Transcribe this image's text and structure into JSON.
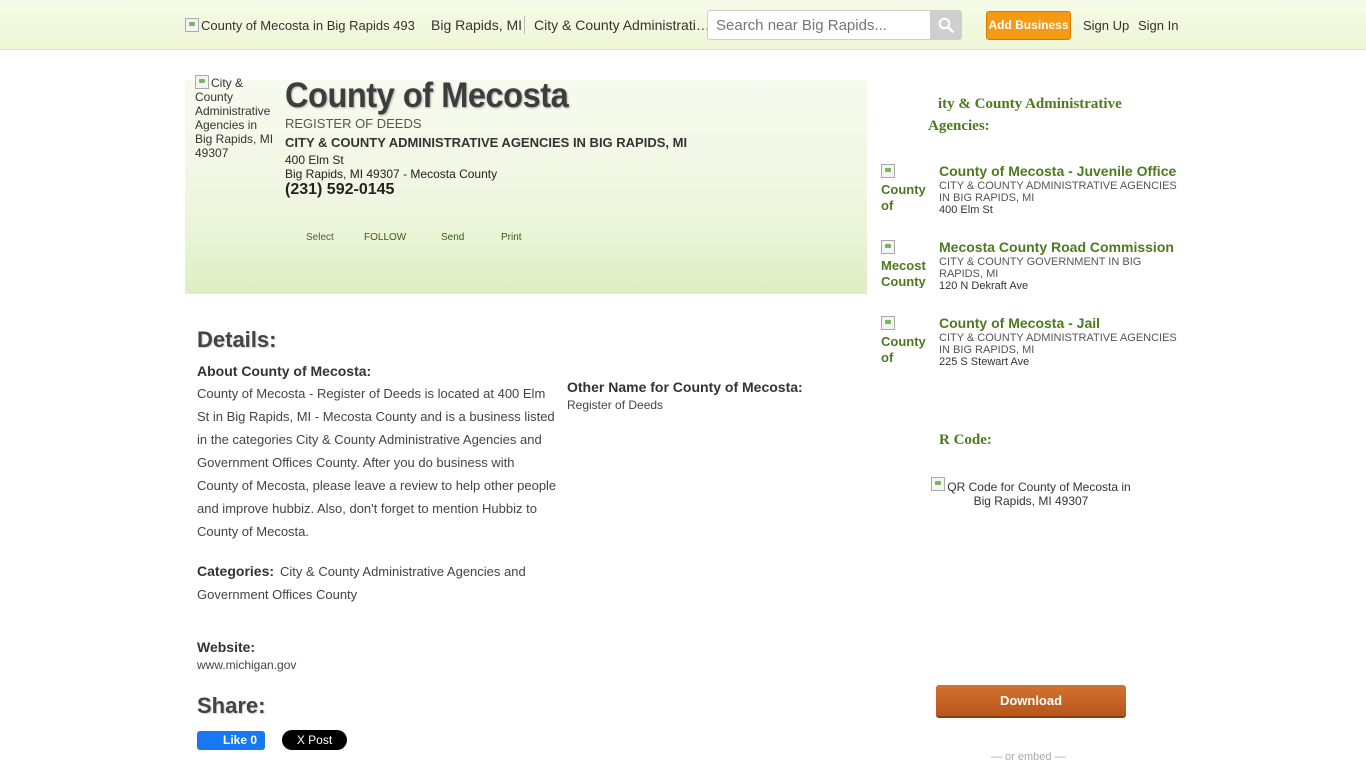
{
  "header": {
    "logo_alt": "County of Mecosta in Big Rapids 49307",
    "crumb_city": "Big Rapids, MI",
    "crumb_category": "City & County Administrati…",
    "search_placeholder": "Search near Big Rapids...",
    "add_business": "Add Business",
    "sign_up": "Sign Up",
    "sign_in": "Sign In"
  },
  "business": {
    "image_alt": "City & County Administrative Agencies in Big Rapids, MI 49307",
    "name": "County of Mecosta",
    "subtitle": "REGISTER OF DEEDS",
    "category_line": "CITY & COUNTY ADMINISTRATIVE AGENCIES IN BIG RAPIDS, MI",
    "address_line1": "400 Elm St",
    "address_line2": "Big Rapids, MI 49307 - Mecosta County",
    "phone": "(231) 592-0145",
    "actions": {
      "select": "Select",
      "follow": "FOLLOW",
      "send": "Send",
      "print": "Print"
    }
  },
  "details": {
    "heading": "Details:",
    "about_label": "About County of Mecosta:",
    "about_text": "County of Mecosta - Register of Deeds is located at 400 Elm St in Big Rapids, MI - Mecosta County and is a business listed in the categories City & County Administrative Agencies and Government Offices County. After you do business with County of Mecosta, please leave a review to help other people and improve hubbiz. Also, don't forget to mention Hubbiz to County of Mecosta.",
    "other_name_label": "Other Name for County of Mecosta:",
    "other_name_value": "Register of Deeds",
    "categories_label": "Categories:",
    "categories_value": "City & County Administrative Agencies and Government Offices County",
    "website_label": "Website:",
    "website_value": "www.michigan.gov"
  },
  "share": {
    "heading": "Share:",
    "fb_like": "Like 0",
    "tw_post": "X Post"
  },
  "sidebar": {
    "nearby_heading_line1": "ity & County Administrative",
    "nearby_heading_line2": "Agencies:",
    "nearby": [
      {
        "thumb_alt": "County of",
        "title": "County of Mecosta - Juvenile Office",
        "category": "CITY & COUNTY ADMINISTRATIVE AGENCIES IN BIG RAPIDS, MI",
        "address": "400 Elm St"
      },
      {
        "thumb_alt": "Mecost County",
        "title": "Mecosta County Road Commission",
        "category": "CITY & COUNTY GOVERNMENT IN BIG RAPIDS, MI",
        "address": "120 N Dekraft Ave"
      },
      {
        "thumb_alt": "County of",
        "title": "County of Mecosta - Jail",
        "category": "CITY & COUNTY ADMINISTRATIVE AGENCIES IN BIG RAPIDS, MI",
        "address": "225 S Stewart Ave"
      }
    ],
    "qr_heading": "R Code:",
    "qr_alt": "QR Code for County of Mecosta in Big Rapids, MI 49307",
    "download": "Download",
    "or_embed": "— or embed —"
  }
}
